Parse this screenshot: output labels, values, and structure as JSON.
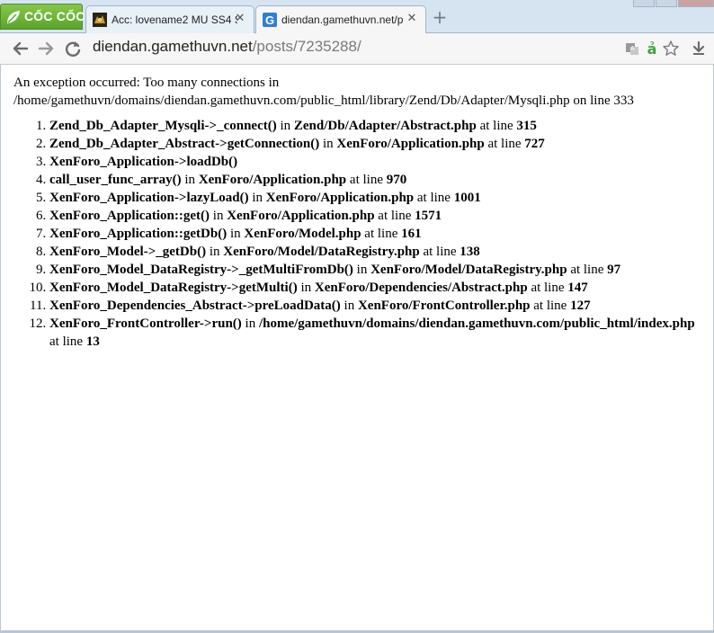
{
  "browser": {
    "brand": "CỐC CỐC",
    "tabs": [
      {
        "title": "Acc: lovename2 MU SS4 S",
        "favicon": "mu-game-icon",
        "active": false
      },
      {
        "title": "diendan.gamethuvn.net/p",
        "favicon": "gamethuvn-g-icon",
        "active": true
      }
    ],
    "new_tab_icon": "plus-icon",
    "colors": {
      "tabstrip": "#d6e4f2",
      "brand_green": "#5aa52b",
      "accent_blue": "#2f7fd1"
    }
  },
  "toolbar": {
    "url_domain": "diendan.gamethuvn.net",
    "url_path": "/posts/7235288/",
    "icons": [
      "back-icon",
      "forward-icon",
      "reload-icon",
      "translate-icon",
      "coccoc-a-icon",
      "star-icon",
      "download-icon"
    ]
  },
  "page": {
    "message_line1": "An exception occurred: Too many connections in",
    "message_line2": "/home/gamethuvn/domains/diendan.gamethuvn.com/public_html/library/Zend/Db/Adapter/Mysqli.php on line 333",
    "trace": [
      {
        "fn": "Zend_Db_Adapter_Mysqli->_connect()",
        "file": "Zend/Db/Adapter/Abstract.php",
        "line": "315"
      },
      {
        "fn": "Zend_Db_Adapter_Abstract->getConnection()",
        "file": "XenForo/Application.php",
        "line": "727"
      },
      {
        "fn": "XenForo_Application->loadDb()",
        "file": "",
        "line": ""
      },
      {
        "fn": "call_user_func_array()",
        "file": "XenForo/Application.php",
        "line": "970"
      },
      {
        "fn": "XenForo_Application->lazyLoad()",
        "file": "XenForo/Application.php",
        "line": "1001"
      },
      {
        "fn": "XenForo_Application::get()",
        "file": "XenForo/Application.php",
        "line": "1571"
      },
      {
        "fn": "XenForo_Application::getDb()",
        "file": "XenForo/Model.php",
        "line": "161"
      },
      {
        "fn": "XenForo_Model->_getDb()",
        "file": "XenForo/Model/DataRegistry.php",
        "line": "138"
      },
      {
        "fn": "XenForo_Model_DataRegistry->_getMultiFromDb()",
        "file": "XenForo/Model/DataRegistry.php",
        "line": "97"
      },
      {
        "fn": "XenForo_Model_DataRegistry->getMulti()",
        "file": "XenForo/Dependencies/Abstract.php",
        "line": "147"
      },
      {
        "fn": "XenForo_Dependencies_Abstract->preLoadData()",
        "file": "XenForo/FrontController.php",
        "line": "127"
      },
      {
        "fn": "XenForo_FrontController->run()",
        "file": "/home/gamethuvn/domains/diendan.gamethuvn.com/public_html/index.php",
        "line": "13"
      }
    ],
    "in_word": "in",
    "at_line_word": "at line"
  }
}
